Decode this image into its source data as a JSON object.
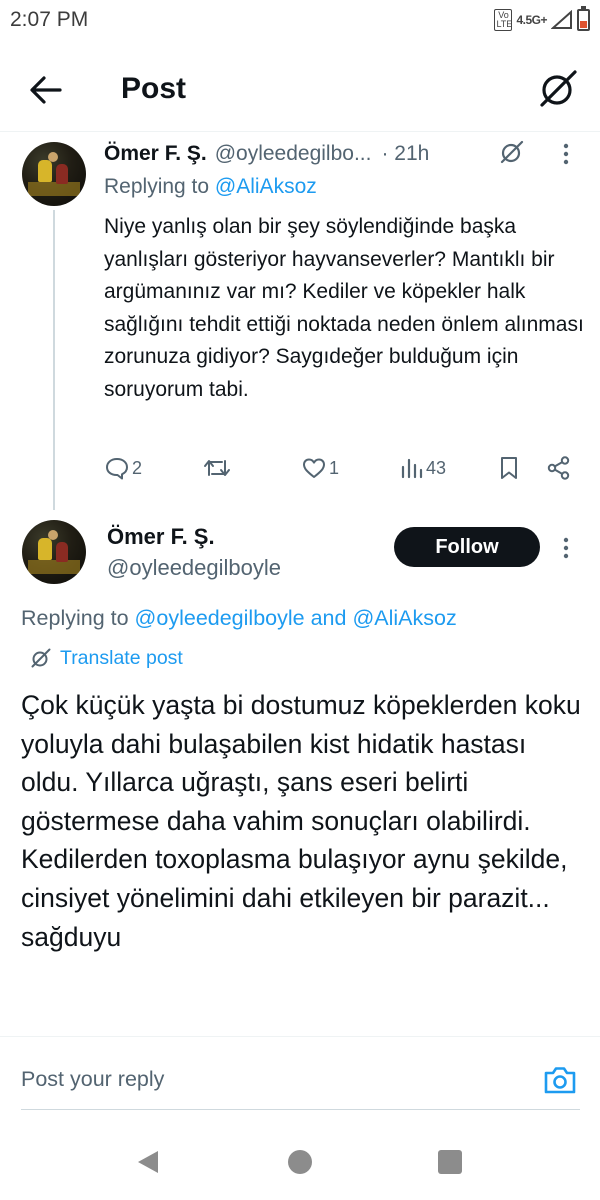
{
  "status_bar": {
    "time": "2:07 PM",
    "volte": "Vo LTE",
    "network": "4.5G+",
    "battery_level": 0.4
  },
  "header": {
    "title": "Post",
    "back_icon": "arrow-left-icon",
    "grok_icon": "grok-icon"
  },
  "reply_tweet": {
    "name": "Ömer F. Ş.",
    "handle": "@oyleedegilbo...",
    "time": "· 21h",
    "replying_prefix": "Replying to ",
    "replying_to": "@AliAksoz",
    "text": "Niye yanlış olan bir şey söylendiğinde başka yanlışları gösteriyor hayvanseverler? Mantıklı bir argümanınız var mı? Kediler ve köpekler halk sağlığını tehdit ettiği noktada neden önlem alınması zorunuza gidiyor? Saygıdeğer bulduğum için soruyorum tabi.",
    "actions": {
      "replies": "2",
      "reposts": "",
      "likes": "1",
      "views": "43"
    }
  },
  "main_post": {
    "name": "Ömer F. Ş.",
    "handle": "@oyleedegilboyle",
    "follow_label": "Follow",
    "replying_prefix": "Replying to ",
    "replying_to_1": "@oyleedegilboyle",
    "replying_and": " and ",
    "replying_to_2": "@AliAksoz",
    "translate_label": "Translate post",
    "text": "Çok küçük yaşta bi dostumuz köpeklerden koku yoluyla dahi bulaşabilen kist hidatik hastası oldu. Yıllarca uğraştı, şans eseri belirti göstermese daha vahim sonuçları olabilirdi. Kedilerden toxoplasma bulaşıyor aynu şekilde, cinsiyet yönelimini dahi etkileyen bir parazit... sağduyu"
  },
  "reply_bar": {
    "placeholder": "Post your reply",
    "camera_icon": "camera-icon"
  },
  "colors": {
    "text": "#0f1419",
    "secondary": "#536471",
    "link": "#1d9bf0",
    "follow_bg": "#0f1419"
  }
}
